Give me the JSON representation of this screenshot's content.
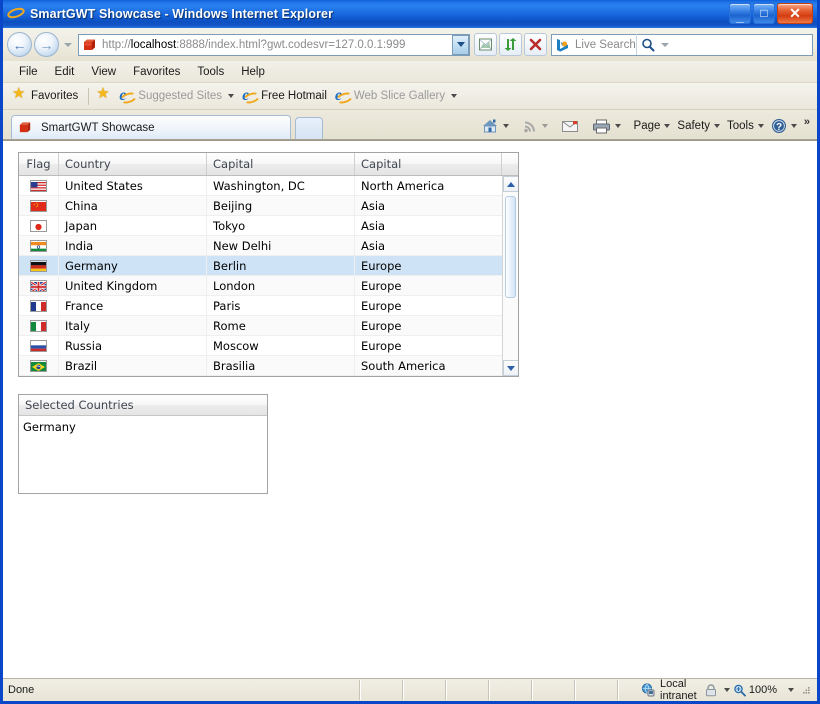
{
  "window": {
    "title": "SmartGWT Showcase - Windows Internet Explorer",
    "minimize_label": "_",
    "maximize_label": "□",
    "close_label": "✕"
  },
  "navigation": {
    "back_label": "←",
    "forward_label": "→",
    "recent_pages_label": "",
    "address": {
      "prefix": "http://",
      "host": "localhost",
      "rest": ":8888/index.html?gwt.codesvr=127.0.0.1:999",
      "full": "http://localhost:8888/index.html?gwt.codesvr=127.0.0.1:999"
    },
    "compat_view_title": "Compatibility View",
    "refresh_title": "Refresh",
    "stop_title": "Stop",
    "stop_glyph": "✕",
    "search": {
      "placeholder": "Live Search",
      "value": "",
      "go_glyph": "⚲"
    }
  },
  "menubar": {
    "items": [
      "File",
      "Edit",
      "View",
      "Favorites",
      "Tools",
      "Help"
    ]
  },
  "favoritesbar": {
    "favorites_label": "Favorites",
    "items": [
      {
        "label": "Suggested Sites",
        "dim": true,
        "caret": true
      },
      {
        "label": "Free Hotmail",
        "dim": false,
        "caret": false
      },
      {
        "label": "Web Slice Gallery",
        "dim": true,
        "caret": true
      }
    ]
  },
  "tabbar": {
    "tabs": [
      {
        "label": "SmartGWT Showcase",
        "active": true
      }
    ],
    "new_tab_label": "",
    "commands": [
      {
        "label": "",
        "icon": "home-icon",
        "caret": true
      },
      {
        "label": "",
        "icon": "feeds-icon",
        "caret": true
      },
      {
        "label": "",
        "icon": "mail-icon",
        "caret": false
      },
      {
        "label": "",
        "icon": "print-icon",
        "caret": true
      },
      {
        "label": "Page",
        "icon": "",
        "caret": true
      },
      {
        "label": "Safety",
        "icon": "",
        "caret": true
      },
      {
        "label": "Tools",
        "icon": "",
        "caret": true
      },
      {
        "label": "",
        "icon": "help-icon",
        "caret": true
      }
    ],
    "overflow_label": "»"
  },
  "grid": {
    "columns": [
      "Flag",
      "Country",
      "Capital",
      "Capital"
    ],
    "rows": [
      {
        "flag": "us",
        "country": "United States",
        "capital": "Washington, DC",
        "continent": "North America",
        "selected": false
      },
      {
        "flag": "cn",
        "country": "China",
        "capital": "Beijing",
        "continent": "Asia",
        "selected": false
      },
      {
        "flag": "jp",
        "country": "Japan",
        "capital": "Tokyo",
        "continent": "Asia",
        "selected": false
      },
      {
        "flag": "in",
        "country": "India",
        "capital": "New Delhi",
        "continent": "Asia",
        "selected": false
      },
      {
        "flag": "de",
        "country": "Germany",
        "capital": "Berlin",
        "continent": "Europe",
        "selected": true
      },
      {
        "flag": "gb",
        "country": "United Kingdom",
        "capital": "London",
        "continent": "Europe",
        "selected": false
      },
      {
        "flag": "fr",
        "country": "France",
        "capital": "Paris",
        "continent": "Europe",
        "selected": false
      },
      {
        "flag": "it",
        "country": "Italy",
        "capital": "Rome",
        "continent": "Europe",
        "selected": false
      },
      {
        "flag": "ru",
        "country": "Russia",
        "capital": "Moscow",
        "continent": "Europe",
        "selected": false
      },
      {
        "flag": "br",
        "country": "Brazil",
        "capital": "Brasilia",
        "continent": "South America",
        "selected": false
      }
    ]
  },
  "selected_panel": {
    "title": "Selected Countries",
    "items": [
      "Germany"
    ]
  },
  "statusbar": {
    "status": "Done",
    "zone": "Local intranet",
    "zoom": "100%",
    "zoom_caret": "▾"
  },
  "colors": {
    "titlebar_blue": "#1564dc",
    "window_border": "#0a46c8",
    "chrome_beige": "#ece9d8",
    "selection_blue": "#cfe3f7",
    "header_text": "#3f4650"
  }
}
